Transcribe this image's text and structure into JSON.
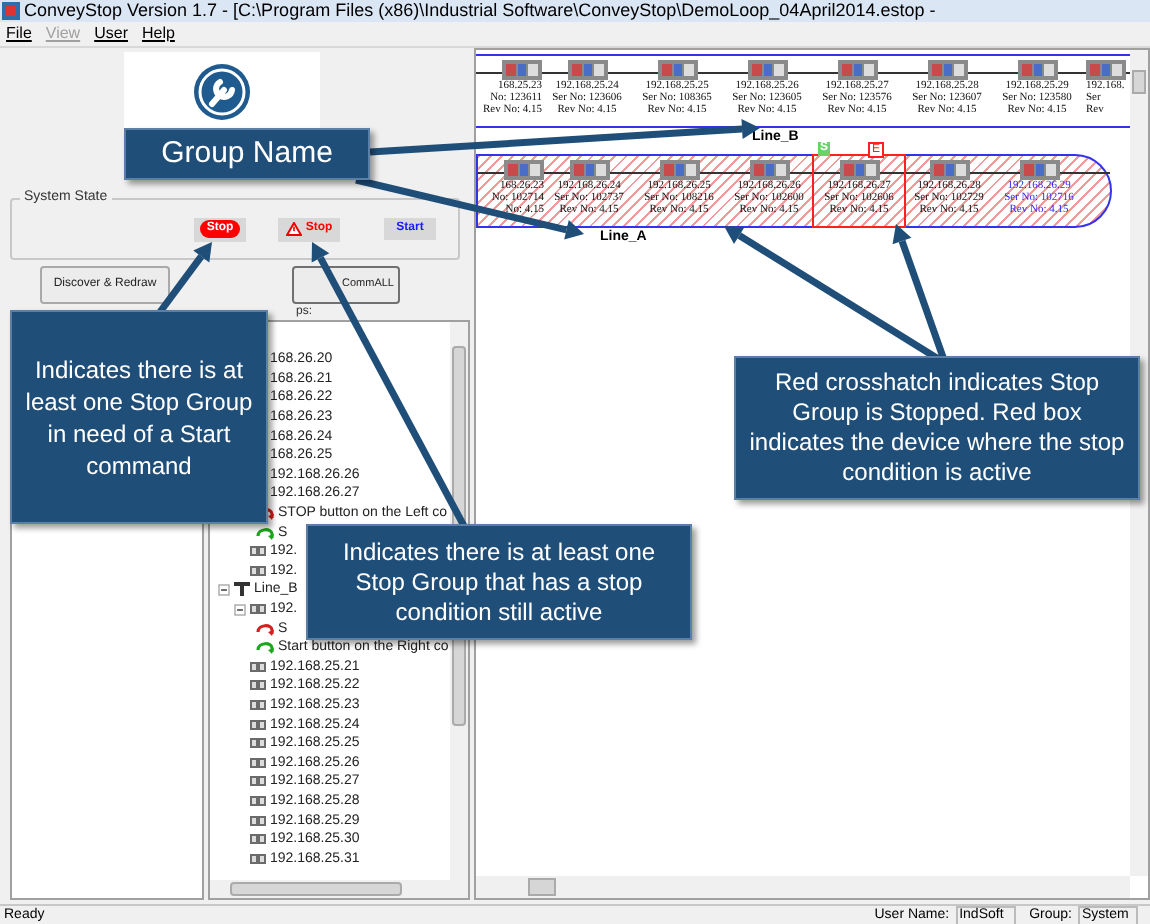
{
  "window": {
    "title": "ConveyStop Version 1.7 - [C:\\Program Files (x86)\\Industrial Software\\ConveyStop\\DemoLoop_04April2014.estop -"
  },
  "menu": [
    {
      "label": "File",
      "disabled": false
    },
    {
      "label": "View",
      "disabled": true
    },
    {
      "label": "User",
      "disabled": false
    },
    {
      "label": "Help",
      "disabled": false
    }
  ],
  "system_state": {
    "title": "System State",
    "indicators": [
      {
        "kind": "stop_needed",
        "label": "Stop"
      },
      {
        "kind": "stop_active",
        "label": "Stop"
      },
      {
        "kind": "start",
        "label": "Start"
      }
    ]
  },
  "buttons": [
    "Discover & Redraw",
    "Comm"
  ],
  "buttons_suffix": "ALL",
  "groups_label": "ps:",
  "tree": {
    "groups": [
      {
        "children": [
          {
            "label": "168.26.20"
          },
          {
            "label": "168.26.21"
          },
          {
            "label": "168.26.22"
          },
          {
            "label": "168.26.23"
          },
          {
            "label": "168.26.24"
          },
          {
            "label": "168.26.25"
          },
          {
            "label": "192.168.26.26"
          },
          {
            "label": "192.168.26.27",
            "children": [
              {
                "kind": "stop",
                "label": "STOP button on the Left co"
              },
              {
                "kind": "start",
                "label": "S"
              }
            ]
          },
          {
            "label": "192."
          },
          {
            "label": "192."
          }
        ]
      },
      {
        "label": "Line_B",
        "expanded": true,
        "children": [
          {
            "label": "192.",
            "expanded": true,
            "children": [
              {
                "kind": "stop",
                "label": "S"
              },
              {
                "kind": "start",
                "label": "Start button on the Right co"
              }
            ]
          },
          {
            "label": "192.168.25.21"
          },
          {
            "label": "192.168.25.22"
          },
          {
            "label": "192.168.25.23"
          },
          {
            "label": "192.168.25.24"
          },
          {
            "label": "192.168.25.25"
          },
          {
            "label": "192.168.25.26"
          },
          {
            "label": "192.168.25.27"
          },
          {
            "label": "192.168.25.28"
          },
          {
            "label": "192.168.25.29"
          },
          {
            "label": "192.168.25.30"
          },
          {
            "label": "192.168.25.31"
          }
        ]
      }
    ]
  },
  "lines": [
    {
      "name": "Line_B",
      "stopped": false,
      "devices": [
        {
          "ip": "168.25.23",
          "ser": "No: 123611",
          "rev": "Rev No: 4.15"
        },
        {
          "ip": "192.168.25.24",
          "ser": "Ser No: 123606",
          "rev": "Rev No: 4.15"
        },
        {
          "ip": "192.168.25.25",
          "ser": "Ser No: 108365",
          "rev": "Rev No: 4.15"
        },
        {
          "ip": "192.168.25.26",
          "ser": "Ser No: 123605",
          "rev": "Rev No: 4.15"
        },
        {
          "ip": "192.168.25.27",
          "ser": "Ser No: 123576",
          "rev": "Rev No: 4.15"
        },
        {
          "ip": "192.168.25.28",
          "ser": "Ser No: 123607",
          "rev": "Rev No: 4.15"
        },
        {
          "ip": "192.168.25.29",
          "ser": "Ser No: 123580",
          "rev": "Rev No: 4.15"
        },
        {
          "ip": "192.168.",
          "ser": "Ser",
          "rev": "Rev"
        }
      ]
    },
    {
      "name": "Line_A",
      "stopped": true,
      "devices": [
        {
          "ip": "168.26.23",
          "ser": "No: 102714",
          "rev": "No: 4.15"
        },
        {
          "ip": "192.168.26.24",
          "ser": "Ser No: 102737",
          "rev": "Rev No: 4.15"
        },
        {
          "ip": "192.168.26.25",
          "ser": "Ser No: 108216",
          "rev": "Rev No: 4.15"
        },
        {
          "ip": "192.168.26.26",
          "ser": "Ser No: 102600",
          "rev": "Rev No: 4.15"
        },
        {
          "ip": "192.168.26.27",
          "ser": "Ser No: 102606",
          "rev": "Rev No: 4.15",
          "fault": true,
          "start_marker": "S",
          "end_marker": "E"
        },
        {
          "ip": "192.168.26.28",
          "ser": "Ser No: 102729",
          "rev": "Rev No: 4.15"
        },
        {
          "ip": "192.168.26.29",
          "ser": "Ser No: 102716",
          "rev": "Rev No: 4.15",
          "highlight": true
        }
      ]
    }
  ],
  "callouts": [
    {
      "kind": "group",
      "text": "Group Name"
    },
    {
      "kind": "start_needed",
      "text": "Indicates there is at least one Stop Group in need of a Start command"
    },
    {
      "kind": "stop_active",
      "text": "Indicates there is at least one Stop Group that has a stop condition still active"
    },
    {
      "kind": "crosshatch",
      "text": "Red crosshatch indicates Stop Group is Stopped.  Red box indicates the device where the stop condition is active"
    }
  ],
  "status_bar": {
    "text": "Ready",
    "user_label": "User Name:",
    "user": "IndSoft",
    "group_label": "Group:",
    "group": "System"
  }
}
